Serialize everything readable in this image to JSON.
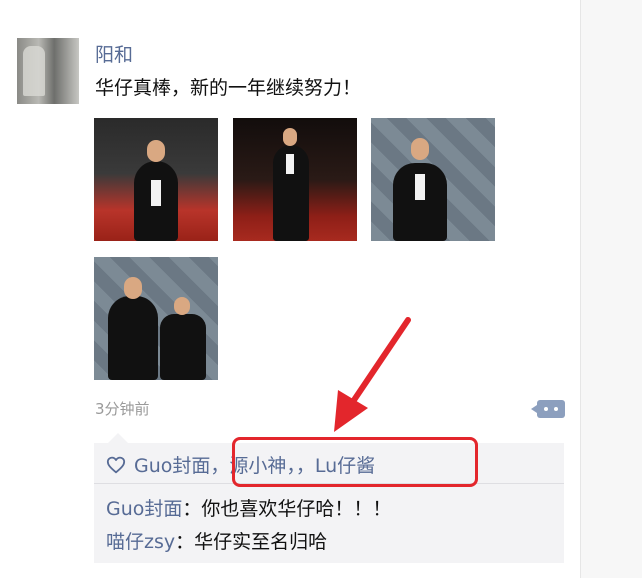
{
  "post": {
    "author": "阳和",
    "text": "华仔真棒，新的一年继续努力！",
    "timestamp": "3分钟前",
    "photo_count": 4
  },
  "likes": {
    "names": [
      "Guo封面",
      "源小神",
      "",
      "Lu仔酱"
    ],
    "display": "Guo封面，源小神，，Lu仔酱"
  },
  "comments": [
    {
      "name": "Guo封面",
      "separator": "：",
      "text": "你也喜欢华仔哈！！！"
    },
    {
      "name": "喵仔zsy",
      "separator": "：",
      "text": "华仔实至名归哈"
    }
  ],
  "icons": {
    "like": "heart-outline-icon",
    "comment": "comment-dots-icon"
  },
  "colors": {
    "link": "#576b95",
    "annotation": "#e3262c",
    "panel": "#f3f3f5"
  }
}
